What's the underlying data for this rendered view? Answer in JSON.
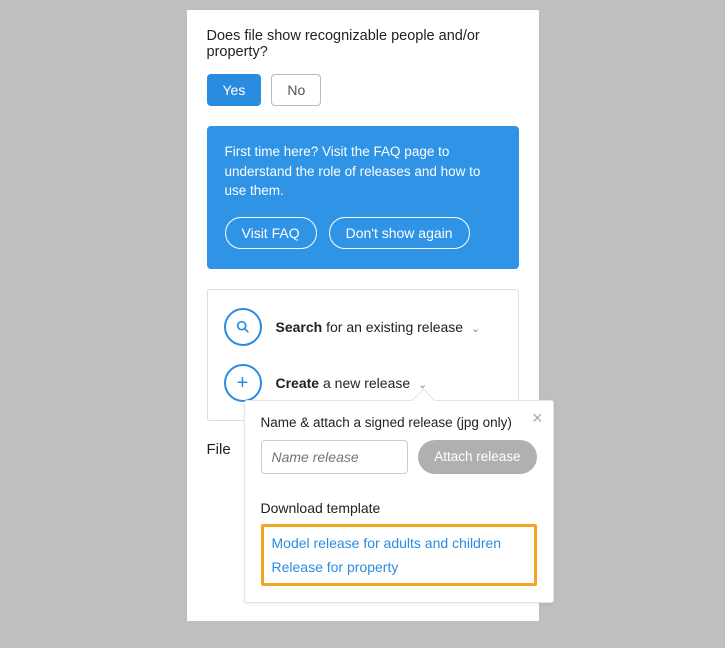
{
  "question": "Does file show recognizable people and/or property?",
  "yes": "Yes",
  "no": "No",
  "notice": {
    "text": "First time here? Visit the FAQ page to understand the role of releases and how to use them.",
    "visit": "Visit FAQ",
    "dont": "Don't show again"
  },
  "search": {
    "bold": "Search",
    "rest": " for an existing release"
  },
  "create": {
    "bold": "Create",
    "rest": " a new release"
  },
  "fileLabel": "File",
  "popover": {
    "title": "Name & attach a signed release (jpg only)",
    "placeholder": "Name release",
    "attach": "Attach release",
    "download": "Download template",
    "link1": "Model release for adults and children",
    "link2": "Release for property"
  }
}
